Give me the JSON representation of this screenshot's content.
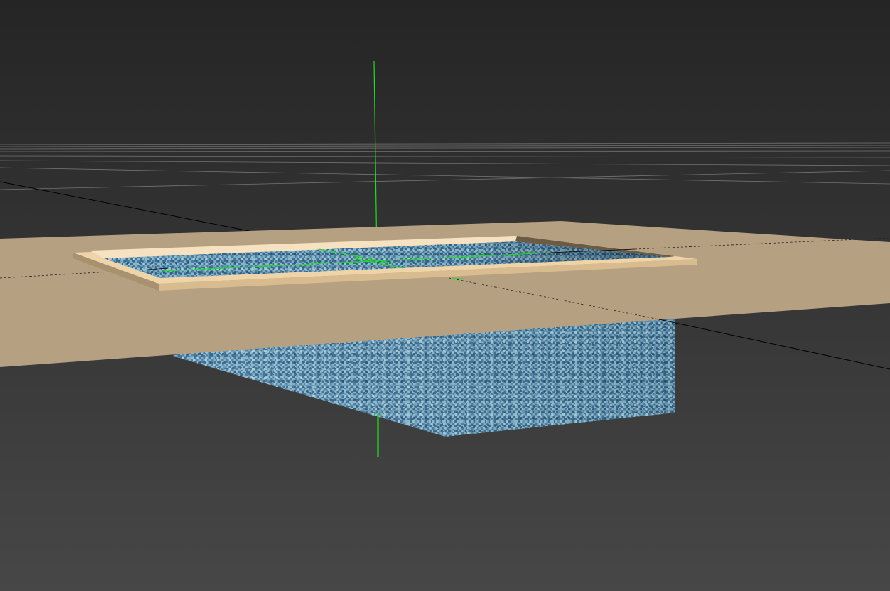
{
  "viewport": {
    "background_top": "#252525",
    "background_bottom": "#474747",
    "grid_color": "#8a8a8a",
    "axis_line_color": "#000000",
    "gizmo_color": "#22dd22"
  },
  "scene": {
    "objects": [
      {
        "name": "ground-plane",
        "material_color": "#bca687"
      },
      {
        "name": "pool-coping",
        "material_color": "#efd3a9"
      },
      {
        "name": "pool-water-tiles",
        "material": "blue-mosaic-tile",
        "base_color": "#5b8fad"
      }
    ]
  },
  "gizmo": {
    "type": "transform-pivot-icon"
  }
}
